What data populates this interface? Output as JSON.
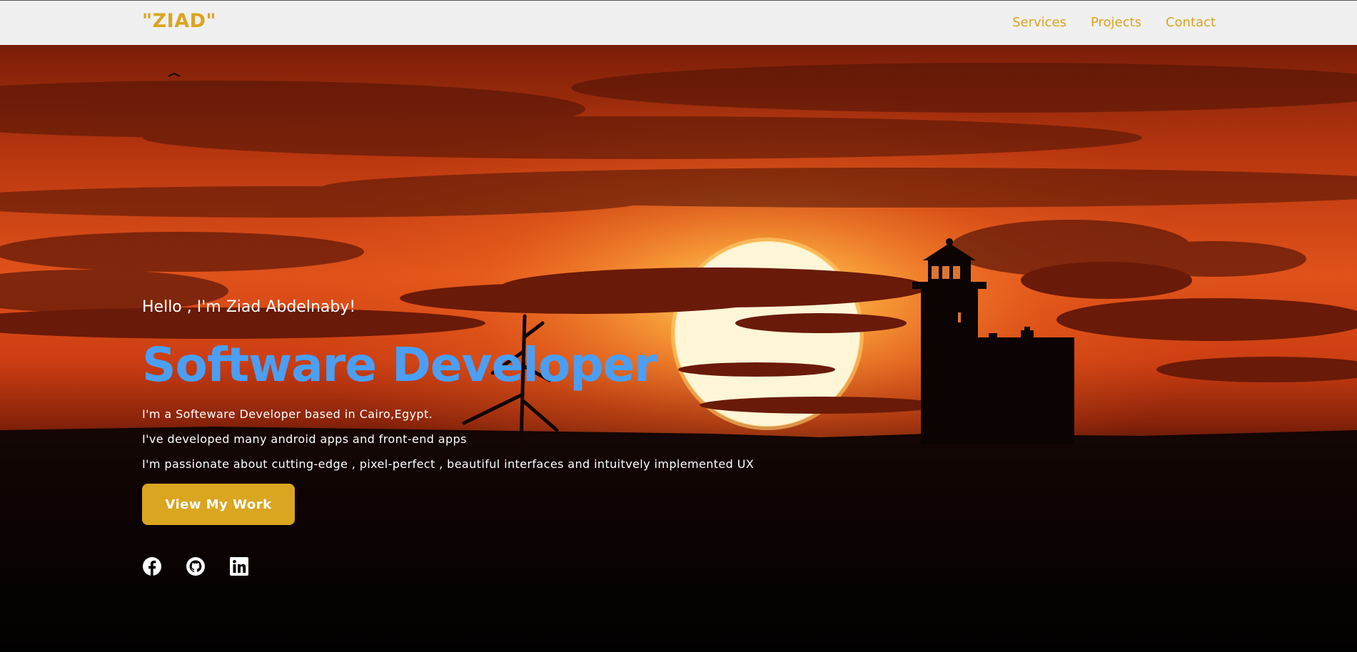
{
  "nav": {
    "brand": "\"ZIAD\"",
    "links": [
      "Services",
      "Projects",
      "Contact"
    ]
  },
  "hero": {
    "greeting": "Hello , I'm Ziad Abdelnaby!",
    "title": "Software Developer",
    "lines": [
      "I'm a Softeware Developer based in Cairo,Egypt.",
      "I've developed many android apps and front-end apps",
      "I'm passionate about cutting-edge , pixel-perfect , beautiful interfaces and intuitvely implemented UX"
    ],
    "cta_label": "View My Work"
  },
  "socials": {
    "icons": [
      "facebook-icon",
      "github-icon",
      "linkedin-icon"
    ]
  },
  "colors": {
    "accent": "#daa520",
    "title": "#4a9ff5",
    "navbar_bg": "#f0f0f0"
  }
}
